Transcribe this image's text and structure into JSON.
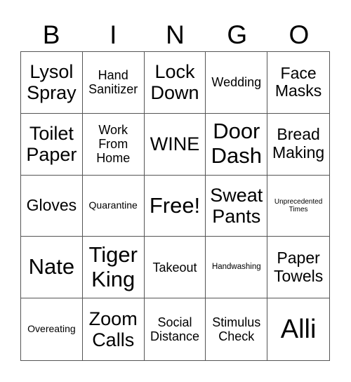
{
  "header": {
    "letters": [
      "B",
      "I",
      "N",
      "G",
      "O"
    ]
  },
  "grid": {
    "rows": [
      [
        {
          "text": "Lysol Spray",
          "size": "l"
        },
        {
          "text": "Hand Sanitizer",
          "size": "s"
        },
        {
          "text": "Lock Down",
          "size": "l"
        },
        {
          "text": "Wedding",
          "size": "s"
        },
        {
          "text": "Face Masks",
          "size": "m"
        }
      ],
      [
        {
          "text": "Toilet Paper",
          "size": "l"
        },
        {
          "text": "Work From Home",
          "size": "s"
        },
        {
          "text": "WINE",
          "size": "l"
        },
        {
          "text": "Door Dash",
          "size": "xl"
        },
        {
          "text": "Bread Making",
          "size": "m"
        }
      ],
      [
        {
          "text": "Gloves",
          "size": "m"
        },
        {
          "text": "Quarantine",
          "size": "xs"
        },
        {
          "text": "Free!",
          "size": "xl"
        },
        {
          "text": "Sweat Pants",
          "size": "l"
        },
        {
          "text": "Unprecedented Times",
          "size": "xxs"
        }
      ],
      [
        {
          "text": "Nate",
          "size": "xl"
        },
        {
          "text": "Tiger King",
          "size": "xl"
        },
        {
          "text": "Takeout",
          "size": "s"
        },
        {
          "text": "Handwashing",
          "size": "xxs2"
        },
        {
          "text": "Paper Towels",
          "size": "m"
        }
      ],
      [
        {
          "text": "Overeating",
          "size": "xs"
        },
        {
          "text": "Zoom Calls",
          "size": "l"
        },
        {
          "text": "Social Distance",
          "size": "s"
        },
        {
          "text": "Stimulus Check",
          "size": "s"
        },
        {
          "text": "Alli",
          "size": "xxl"
        }
      ]
    ]
  }
}
